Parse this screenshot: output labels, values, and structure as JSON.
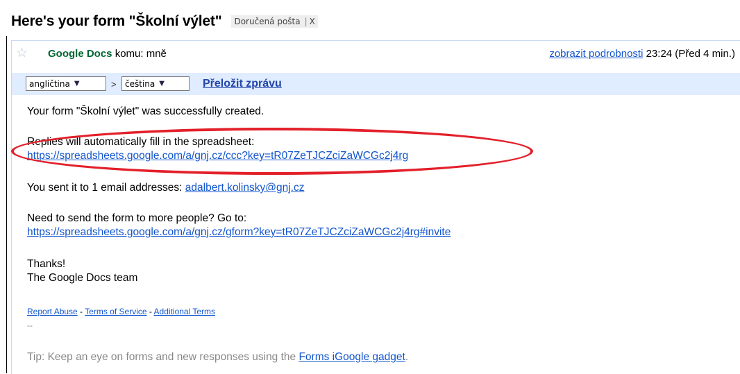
{
  "subject": "Here's your form \"Školní výlet\"",
  "label_tag": {
    "name": "Doručená pošta",
    "close": "X"
  },
  "message_header": {
    "sender_name": "Google Docs",
    "recipient": "komu: mně",
    "details_link": "zobrazit podrobnosti",
    "time": "23:24 (Před 4 min.)"
  },
  "translate_bar": {
    "source_language": "angličtina",
    "arrow": ">",
    "target_language": "čeština",
    "translate_link": "Přeložit zprávu"
  },
  "body": {
    "line1": "Your form \"Školní výlet\" was successfully created.",
    "replies_text": "Replies will automatically fill in the spreadsheet:",
    "spreadsheet_link": "https://spreadsheets.google.com/a/gnj.cz/ccc?key=tR07ZeTJCZciZaWCGc2j4rg",
    "sent_text": "You sent it to 1 email addresses:",
    "sent_email": "adalbert.kolinsky@gnj.cz",
    "more_people_text": "Need to send the form to more people? Go to:",
    "invite_link": "https://spreadsheets.google.com/a/gnj.cz/gform?key=tR07ZeTJCZciZaWCGc2j4rg#invite",
    "thanks": "Thanks!",
    "signature": "The Google Docs team",
    "footer_links": [
      "Report Abuse",
      "Terms of Service",
      "Additional Terms"
    ],
    "footer_sep": " - ",
    "sig_dashes": "--",
    "tip_text": "Tip: Keep an eye on forms and new responses using the ",
    "tip_link": "Forms iGoogle gadget",
    "tip_end": "."
  },
  "colors": {
    "highlight": "#e3202a",
    "sender": "#006633",
    "translate_bar": "#e0ecff"
  }
}
